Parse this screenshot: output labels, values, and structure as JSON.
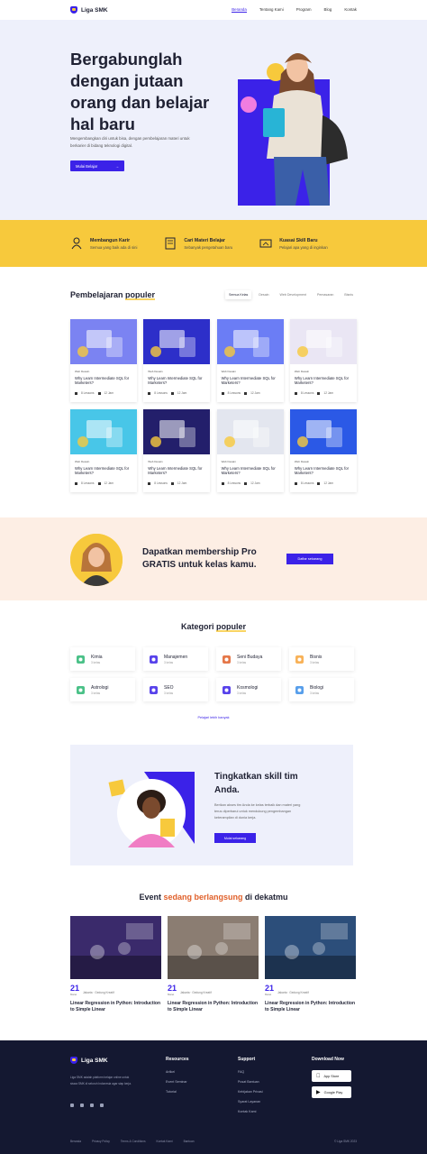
{
  "brand": {
    "name": "Liga SMK"
  },
  "nav": {
    "links": [
      "Beranda",
      "Tentang Kami",
      "Program",
      "Blog",
      "Kontak"
    ]
  },
  "hero": {
    "title": "Bergabunglah dengan jutaan orang dan belajar hal baru",
    "desc": "Mengembangkan diri untuk bisa, dengan pembelajaran materi untuk berkarier di bidang teknologi digital.",
    "button": "Mulai Belajar"
  },
  "features": [
    {
      "icon": "career-icon",
      "title": "Membangun Karir",
      "desc": "Semua yang baik ada di sini"
    },
    {
      "icon": "book-icon",
      "title": "Cari Materi Belajar",
      "desc": "Sebanyak pengetahuan baru"
    },
    {
      "icon": "skill-icon",
      "title": "Kuasai Skill Baru",
      "desc": "Pelajari apa yang di inginkan"
    }
  ],
  "courses": {
    "title_prefix": "Pembelajaran ",
    "title_highlight": "populer",
    "tabs": [
      "Semua Kelas",
      "Desain",
      "Web Development",
      "Pemasaran",
      "Bisnis"
    ],
    "items": [
      {
        "cat": "Web Desain",
        "title": "Why Learn Intermediate SQL for Marketers?",
        "lessons": "8 Lessons",
        "duration": "12 Jam",
        "bg": "#7b83f2"
      },
      {
        "cat": "Web Desain",
        "title": "Why Learn Intermediate SQL for Marketers?",
        "lessons": "8 Lessons",
        "duration": "12 Jam",
        "bg": "#2d2fc9"
      },
      {
        "cat": "Web Desain",
        "title": "Why Learn Intermediate SQL for Marketers?",
        "lessons": "8 Lessons",
        "duration": "12 Jam",
        "bg": "#6b7df5"
      },
      {
        "cat": "Web Desain",
        "title": "Why Learn Intermediate SQL for Marketers?",
        "lessons": "8 Lessons",
        "duration": "12 Jam",
        "bg": "#eae6f4"
      },
      {
        "cat": "Web Desain",
        "title": "Why Learn Intermediate SQL for Marketers?",
        "lessons": "8 Lessons",
        "duration": "12 Jam",
        "bg": "#48c6e8"
      },
      {
        "cat": "Web Desain",
        "title": "Why Learn Intermediate SQL for Marketers?",
        "lessons": "8 Lessons",
        "duration": "12 Jam",
        "bg": "#231f6b"
      },
      {
        "cat": "Web Desain",
        "title": "Why Learn Intermediate SQL for Marketers?",
        "lessons": "8 Lessons",
        "duration": "12 Jam",
        "bg": "#e3e6ef"
      },
      {
        "cat": "Web Desain",
        "title": "Why Learn Intermediate SQL for Marketers?",
        "lessons": "8 Lessons",
        "duration": "12 Jam",
        "bg": "#2b59e6"
      }
    ]
  },
  "membership": {
    "text": "Dapatkan membership Pro GRATIS untuk kelas kamu.",
    "button": "Daftar sekarang"
  },
  "categories": {
    "title_prefix": "Kategori ",
    "title_highlight": "populer",
    "items": [
      {
        "name": "Kimia",
        "count": "3 kelas",
        "icon": "flask-icon",
        "color": "#2bb673"
      },
      {
        "name": "Manajemen",
        "count": "3 kelas",
        "icon": "chart-icon",
        "color": "#3b22e8"
      },
      {
        "name": "Seni Budaya",
        "count": "3 kelas",
        "icon": "palette-icon",
        "color": "#e0602a"
      },
      {
        "name": "Bisnis",
        "count": "3 kelas",
        "icon": "briefcase-icon",
        "color": "#f7a53c"
      },
      {
        "name": "Astrologi",
        "count": "3 kelas",
        "icon": "planet-icon",
        "color": "#2bb673"
      },
      {
        "name": "SEO",
        "count": "3 kelas",
        "icon": "search-icon",
        "color": "#3b22e8"
      },
      {
        "name": "Kosmologi",
        "count": "3 kelas",
        "icon": "galaxy-icon",
        "color": "#3b22e8"
      },
      {
        "name": "Biologi",
        "count": "3 kelas",
        "icon": "leaf-icon",
        "color": "#3b8ee8"
      }
    ],
    "more": "Pelajari lebih banyak"
  },
  "team": {
    "title": "Tingkatkan skill tim Anda.",
    "desc": "Berikan akses tim Anda ke kelas terbaik dan materi yang terus diperbarui untuk mendukung pengembangan keterampilan di dunia kerja.",
    "button": "Mulai sekarang"
  },
  "events": {
    "title_prefix": "Event ",
    "title_highlight": "sedang berlangsung",
    "title_suffix": " di dekatmu",
    "items": [
      {
        "day": "21",
        "month": "Maret",
        "info": "Jakarta · Gedung Kreatif",
        "title": "Linear Regression in Python: Introduction to Simple Linear",
        "bg": "#3a2a6b"
      },
      {
        "day": "21",
        "month": "Maret",
        "info": "Jakarta · Gedung Kreatif",
        "title": "Linear Regression in Python: Introduction to Simple Linear",
        "bg": "#8b7d72"
      },
      {
        "day": "21",
        "month": "Maret",
        "info": "Jakarta · Gedung Kreatif",
        "title": "Linear Regression in Python: Introduction to Simple Linear",
        "bg": "#2c4e7a"
      }
    ]
  },
  "footer": {
    "about": "Liga SMK adalah platform belajar online untuk siswa SMK di seluruh Indonesia agar siap kerja.",
    "resources": {
      "title": "Resources",
      "items": [
        "Artikel",
        "Event Seminar",
        "Tutorial"
      ]
    },
    "support": {
      "title": "Support",
      "items": [
        "FAQ",
        "Pusat Bantuan",
        "Kebijakan Privasi",
        "Syarat Layanan",
        "Kontak Kami"
      ]
    },
    "download": {
      "title": "Download Now",
      "appstore": "App Store",
      "playstore": "Google Play"
    },
    "bottom_links": [
      "Beranda",
      "Privacy Policy",
      "Terms & Conditions",
      "Kontak Kami",
      "Bantuan"
    ],
    "copyright": "© Liga SMK 2023"
  }
}
